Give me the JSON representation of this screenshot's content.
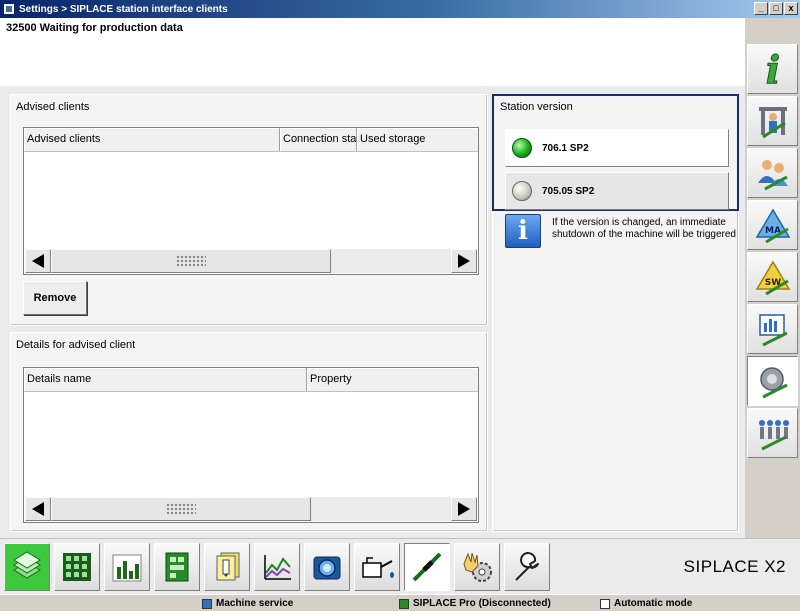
{
  "window": {
    "title": "Settings > SIPLACE station interface clients",
    "controls": {
      "minimize": "_",
      "restore": "□",
      "close": "x"
    }
  },
  "status_message": "32500 Waiting for production data",
  "advised_clients": {
    "group_title": "Advised clients",
    "columns": [
      "Advised clients",
      "Connection state",
      "Used storage"
    ],
    "rows": [],
    "remove_button": "Remove"
  },
  "details": {
    "group_title": "Details for advised client",
    "columns": [
      "Details name",
      "Property"
    ],
    "rows": []
  },
  "station_version": {
    "title": "Station version",
    "options": [
      {
        "label": "706.1 SP2",
        "state": "active",
        "led_color": "#1eb41e"
      },
      {
        "label": "705.05 SP2",
        "state": "inactive",
        "led_color": "#cfcac0"
      }
    ],
    "info_text": "If the version is changed, an immediate shutdown of the machine will be triggered"
  },
  "sidebar": {
    "items": [
      {
        "icon": "info-icon",
        "selected": false
      },
      {
        "icon": "machine-operator-icon",
        "selected": false
      },
      {
        "icon": "users-icon",
        "selected": false
      },
      {
        "icon": "ma-setup-icon",
        "label": "MA",
        "selected": false
      },
      {
        "icon": "sw-setup-icon",
        "label": "SW",
        "selected": false
      },
      {
        "icon": "statistics-icon",
        "selected": false
      },
      {
        "icon": "station-interface-icon",
        "selected": true
      },
      {
        "icon": "line-settings-icon",
        "selected": false
      }
    ]
  },
  "bottom_toolbar": {
    "items": [
      {
        "icon": "production-icon"
      },
      {
        "icon": "grid-icon"
      },
      {
        "icon": "bar-chart-icon"
      },
      {
        "icon": "board-icon"
      },
      {
        "icon": "documents-icon"
      },
      {
        "icon": "line-chart-icon"
      },
      {
        "icon": "camera-icon"
      },
      {
        "icon": "oil-can-icon"
      },
      {
        "icon": "service-tool-icon"
      },
      {
        "icon": "hand-gear-icon"
      },
      {
        "icon": "wrench-icon"
      }
    ],
    "brand": "SIPLACE X2"
  },
  "statusbar": {
    "mode": "Machine service",
    "connection": "SIPLACE Pro (Disconnected)",
    "operation": "Automatic mode"
  }
}
